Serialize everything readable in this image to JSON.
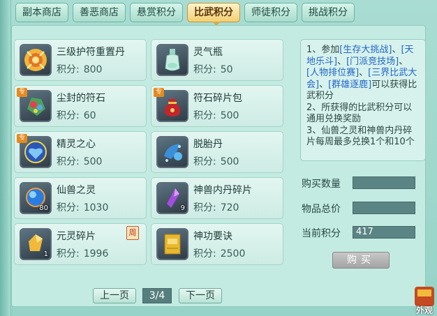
{
  "tabs": [
    {
      "label": "副本商店",
      "active": false
    },
    {
      "label": "善恶商店",
      "active": false
    },
    {
      "label": "悬赏积分",
      "active": false
    },
    {
      "label": "比武积分",
      "active": true
    },
    {
      "label": "师徒积分",
      "active": false
    },
    {
      "label": "挑战积分",
      "active": false
    }
  ],
  "price_label": "积分:",
  "items": [
    {
      "name": "三级护符重置丹",
      "price": "800",
      "icon": "gold-talisman-icon"
    },
    {
      "name": "灵气瓶",
      "price": "50",
      "icon": "spirit-bottle-icon"
    },
    {
      "name": "尘封的符石",
      "price": "60",
      "icon": "rune-stone-icon",
      "special": "专"
    },
    {
      "name": "符石碎片包",
      "price": "500",
      "icon": "red-pouch-icon",
      "special": "专"
    },
    {
      "name": "精灵之心",
      "price": "500",
      "icon": "spirit-heart-icon",
      "special": "专"
    },
    {
      "name": "脱胎丹",
      "price": "500",
      "icon": "rebirth-pill-icon"
    },
    {
      "name": "仙兽之灵",
      "price": "1030",
      "icon": "blue-orb-icon",
      "count": "80"
    },
    {
      "name": "神兽内丹碎片",
      "price": "720",
      "icon": "purple-crystal-icon",
      "count": "9"
    },
    {
      "name": "元灵碎片",
      "price": "1996",
      "icon": "gold-fragment-icon",
      "count": "1",
      "week": "周"
    },
    {
      "name": "神功要诀",
      "price": "2500",
      "icon": "golden-book-icon"
    }
  ],
  "info": {
    "line1_a": "1、参加",
    "link1": "[生存大挑战]",
    "sep": "、",
    "link2": "[天地乐斗]",
    "link3": "[门派竞技场]",
    "link4": "[人物排位赛]",
    "link5": "[三界比武大会]",
    "link6": "[群雄逐鹿]",
    "line1_b": "可以获得比武积分",
    "line2": "2、所获得的比武积分可以通用兑换奖励",
    "line3": "3、仙兽之灵和神兽内丹碎片每周最多兑换1个和10个"
  },
  "form": {
    "quantity_label": "购买数量",
    "quantity_value": "",
    "total_label": "物品总价",
    "total_value": "",
    "current_label": "当前积分",
    "current_value": "417"
  },
  "buy_label": "购买",
  "pager": {
    "prev_label": "上一页",
    "page": "3/4",
    "next_label": "下一页"
  },
  "corner_text": "外观",
  "colors": {
    "accent_tab": "#f2cf73",
    "link": "#2166c9",
    "panel": "#c3ebe2"
  }
}
